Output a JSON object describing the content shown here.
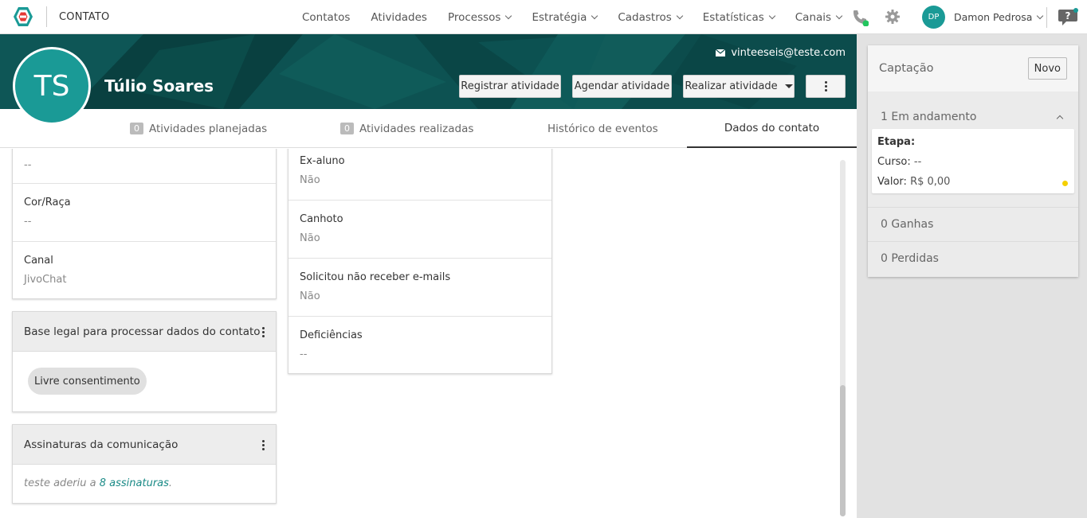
{
  "app": {
    "title": "CONTATO"
  },
  "nav": {
    "items": [
      {
        "label": "Contatos",
        "dropdown": false
      },
      {
        "label": "Atividades",
        "dropdown": false
      },
      {
        "label": "Processos",
        "dropdown": true
      },
      {
        "label": "Estratégia",
        "dropdown": true
      },
      {
        "label": "Cadastros",
        "dropdown": true
      },
      {
        "label": "Estatísticas",
        "dropdown": true
      },
      {
        "label": "Canais",
        "dropdown": true
      }
    ],
    "user": {
      "initials": "DP",
      "name": "Damon Pedrosa"
    }
  },
  "contact": {
    "initials": "TS",
    "name": "Túlio Soares",
    "email": "vinteeseis@teste.com"
  },
  "actions": {
    "register": "Registrar atividade",
    "schedule": "Agendar atividade",
    "perform": "Realizar atividade"
  },
  "tabs": {
    "planned": {
      "count": "0",
      "label": "Atividades planejadas"
    },
    "done": {
      "count": "0",
      "label": "Atividades realizadas"
    },
    "history": {
      "label": "Histórico de eventos"
    },
    "data": {
      "label": "Dados do contato"
    }
  },
  "left_fields": [
    {
      "label": "",
      "value": "--"
    },
    {
      "label": "Cor/Raça",
      "value": "--"
    },
    {
      "label": "Canal",
      "value": "JivoChat"
    }
  ],
  "legal_basis": {
    "title": "Base legal para processar dados do contato",
    "chip": "Livre consentimento"
  },
  "subscriptions": {
    "title": "Assinaturas da comunicação",
    "text_prefix": "teste aderiu a ",
    "link": "8 assinaturas",
    "text_suffix": "."
  },
  "mid_fields": [
    {
      "label": "Ex-aluno",
      "value": "Não"
    },
    {
      "label": "Canhoto",
      "value": "Não"
    },
    {
      "label": "Solicitou não receber e-mails",
      "value": "Não"
    },
    {
      "label": "Deficiências",
      "value": "--"
    }
  ],
  "pipeline": {
    "title": "Captação",
    "new_button": "Novo",
    "in_progress": "1 Em andamento",
    "deal": {
      "stage_label": "Etapa:",
      "stage_value": "",
      "course_label": "Curso:",
      "course_value": "--",
      "value_label": "Valor:",
      "value_value": "R$ 0,00"
    },
    "won": "0 Ganhas",
    "lost": "0 Perdidas"
  },
  "colors": {
    "accent": "#1a9a96",
    "banner": "#0b4a4a",
    "status_online": "#22c55e",
    "deal_status": "#f5d000"
  }
}
